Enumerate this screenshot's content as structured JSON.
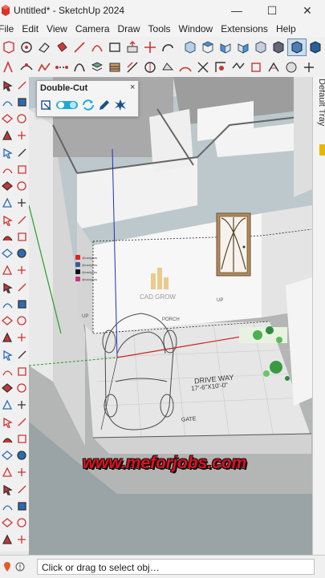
{
  "window": {
    "title": "Untitled* - SketchUp 2024",
    "minimize_glyph": "—",
    "maximize_glyph": "☐",
    "close_glyph": "✕"
  },
  "menu": [
    "File",
    "Edit",
    "View",
    "Camera",
    "Draw",
    "Tools",
    "Window",
    "Extensions",
    "Help"
  ],
  "double_cut_panel": {
    "title": "Double-Cut",
    "close_glyph": "×",
    "icons": [
      "double-cut-square-icon",
      "toggle-icon",
      "refresh-cut-icon",
      "edit-pencil-icon",
      "explode-icon"
    ]
  },
  "default_tray": {
    "label": "Default Tray"
  },
  "status": {
    "text": "Click or drag to select obj…"
  },
  "scene": {
    "porch_label": "PORCH",
    "driveway_label": "DRIVE WAY",
    "driveway_size": "17'-6\"X10'-0\"",
    "gate_label": "GATE",
    "up_label": "UP",
    "logo_text": "CAD GROW",
    "social": [
      "@cadgrow",
      "@cadgrow",
      "@cadgrow",
      "@cadgrow"
    ]
  },
  "watermark": "www.meforjobs.com",
  "colors": {
    "watermark_red": "#e0101d",
    "axis_red": "#d02020",
    "axis_green": "#27a02a",
    "axis_blue": "#2030c0",
    "wall": "#f5f5f5",
    "wall_shade": "#c4c4c4",
    "sky": "#bcc8cc",
    "ground": "#9aa3a6",
    "door_brown": "#b08a5a"
  }
}
